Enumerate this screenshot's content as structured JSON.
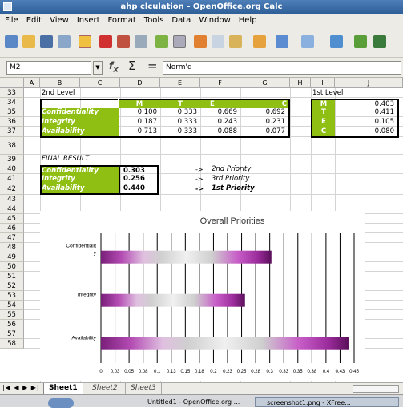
{
  "window": {
    "title": "ahp clculation - OpenOffice.org Calc"
  },
  "menu": [
    "File",
    "Edit",
    "View",
    "Insert",
    "Format",
    "Tools",
    "Data",
    "Window",
    "Help"
  ],
  "formula_bar": {
    "cell_ref": "M2",
    "content": "Norm'd"
  },
  "columns": [
    "A",
    "B",
    "C",
    "D",
    "E",
    "F",
    "G",
    "H",
    "I",
    "J"
  ],
  "rows": [
    "33",
    "34",
    "35",
    "36",
    "37",
    "38",
    "39",
    "40",
    "41",
    "42",
    "43",
    "44",
    "45",
    "46",
    "47",
    "48",
    "49",
    "50",
    "51",
    "52",
    "53",
    "54",
    "55",
    "56",
    "57",
    "58"
  ],
  "sheet": {
    "label_2nd_level": "2nd Level",
    "label_1st_level": "1st Level",
    "matrix_headers": [
      "M",
      "T",
      "E",
      "C"
    ],
    "matrix_rows": [
      {
        "name": "Confidentiality",
        "values": [
          "0.100",
          "0.333",
          "0.669",
          "0.692"
        ]
      },
      {
        "name": "Integrity",
        "values": [
          "0.187",
          "0.333",
          "0.243",
          "0.231"
        ]
      },
      {
        "name": "Availability",
        "values": [
          "0.713",
          "0.333",
          "0.088",
          "0.077"
        ]
      }
    ],
    "first_level": [
      {
        "name": "M",
        "value": "0.403"
      },
      {
        "name": "T",
        "value": "0.411"
      },
      {
        "name": "E",
        "value": "0.105"
      },
      {
        "name": "C",
        "value": "0.080"
      }
    ],
    "final_result_label": "FINAL RESULT",
    "final_rows": [
      {
        "name": "Confidentiality",
        "value": "0.303",
        "arrow": "->",
        "priority": "2nd Priority"
      },
      {
        "name": "Integrity",
        "value": "0.256",
        "arrow": "->",
        "priority": "3rd Priority"
      },
      {
        "name": "Availability",
        "value": "0.440",
        "arrow": "->",
        "priority": "1st Priority"
      }
    ]
  },
  "chart_data": {
    "type": "bar",
    "title": "Overall Priorities",
    "orientation": "horizontal",
    "categories": [
      "Confidentiality",
      "Integrity",
      "Availability"
    ],
    "category_labels": [
      "Confidentialit\ny",
      "Integrity",
      "Availability"
    ],
    "values": [
      0.303,
      0.256,
      0.44
    ],
    "xlim": [
      0,
      0.45
    ],
    "xticks": [
      "0",
      "0.03",
      "0.05",
      "0.08",
      "0.1",
      "0.13",
      "0.15",
      "0.18",
      "0.2",
      "0.23",
      "0.25",
      "0.28",
      "0.3",
      "0.33",
      "0.35",
      "0.38",
      "0.4",
      "0.43",
      "0.45"
    ],
    "grid": true,
    "bar_colors": [
      "#7a1f7a",
      "#b34bb3",
      "#d8d8d8"
    ]
  },
  "tabs": [
    "Sheet1",
    "Sheet2",
    "Sheet3"
  ],
  "taskbar": {
    "items": [
      "Untitled1 - OpenOffice.org ...",
      "screenshot1.png - XFree..."
    ]
  }
}
